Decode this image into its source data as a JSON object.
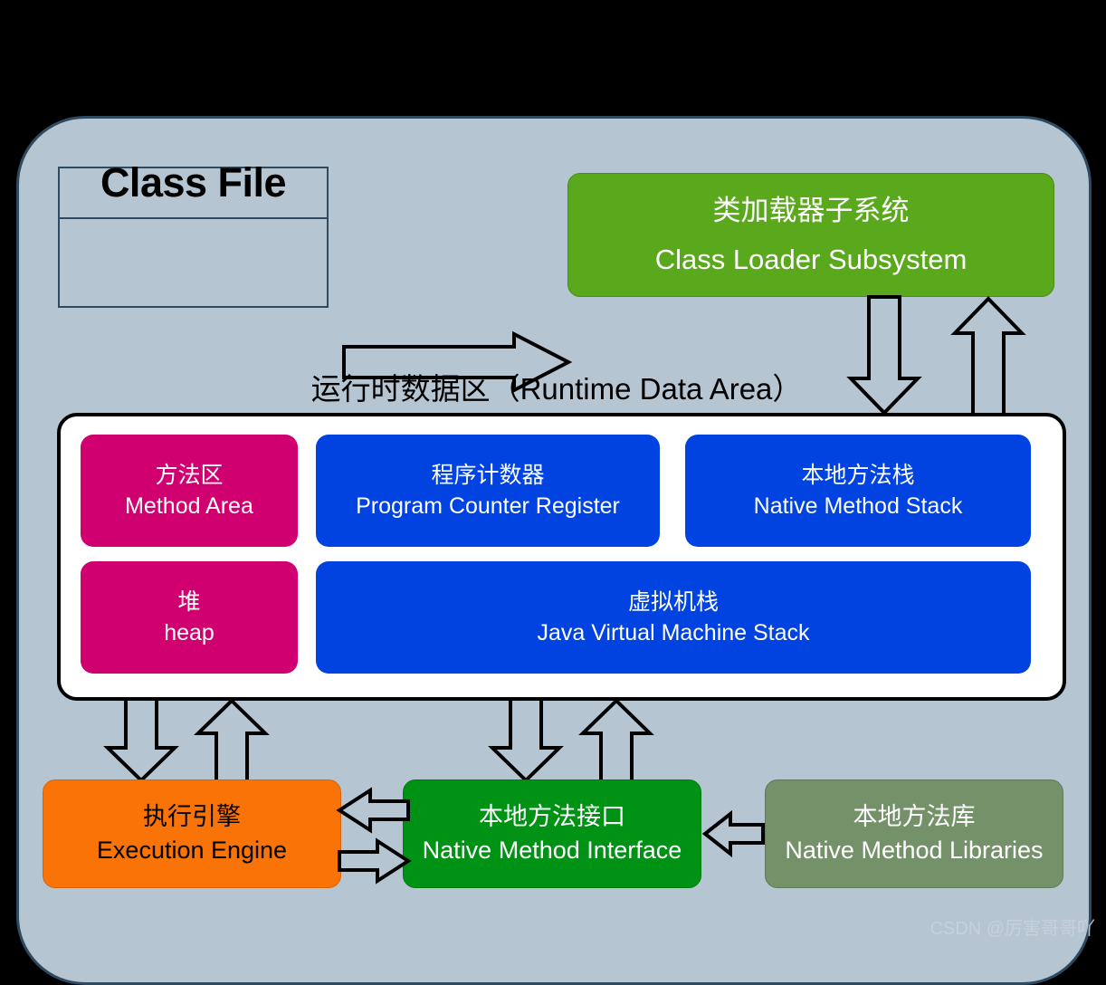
{
  "diagram": {
    "title_class_file": "Class File",
    "runtime_area_label": "运行时数据区（Runtime Data Area）",
    "watermark": "CSDN @厉害哥哥吖"
  },
  "nodes": {
    "class_loader": {
      "cn": "类加载器子系统",
      "en": "Class Loader Subsystem",
      "color": "#5aa81c"
    },
    "method_area": {
      "cn": "方法区",
      "en": "Method Area",
      "color": "#d10070"
    },
    "heap": {
      "cn": "堆",
      "en": "heap",
      "color": "#d10070"
    },
    "pc_register": {
      "cn": "程序计数器",
      "en": "Program Counter Register",
      "color": "#0043e0"
    },
    "native_method_stack": {
      "cn": "本地方法栈",
      "en": "Native Method Stack",
      "color": "#0043e0"
    },
    "jvm_stack": {
      "cn": "虚拟机栈",
      "en": "Java Virtual Machine Stack",
      "color": "#0043e0"
    },
    "execution_engine": {
      "cn": "执行引擎",
      "en": "Execution Engine",
      "color": "#f97306"
    },
    "native_method_interface": {
      "cn": "本地方法接口",
      "en": "Native Method Interface",
      "color": "#009214"
    },
    "native_method_libraries": {
      "cn": "本地方法库",
      "en": "Native Method Libraries",
      "color": "#74916a"
    }
  },
  "arrows": [
    {
      "name": "class-file-to-class-loader",
      "direction": "right"
    },
    {
      "name": "class-loader-to-runtime-down",
      "direction": "down"
    },
    {
      "name": "runtime-to-class-loader-up",
      "direction": "up"
    },
    {
      "name": "runtime-to-execution-engine-down",
      "direction": "down"
    },
    {
      "name": "execution-engine-to-runtime-up",
      "direction": "up"
    },
    {
      "name": "runtime-to-native-interface-down",
      "direction": "down"
    },
    {
      "name": "native-interface-to-runtime-up",
      "direction": "up"
    },
    {
      "name": "native-interface-to-execution-engine-left",
      "direction": "left"
    },
    {
      "name": "execution-engine-to-native-interface-right",
      "direction": "right"
    },
    {
      "name": "native-libraries-to-native-interface-left",
      "direction": "left"
    }
  ],
  "palette": {
    "canvas_background": "#000000",
    "container_fill": "#b6c5d2",
    "container_border": "#2e4a60",
    "runtime_container_fill": "#ffffff",
    "runtime_container_border": "#000000",
    "arrow_outline": "#000000"
  }
}
